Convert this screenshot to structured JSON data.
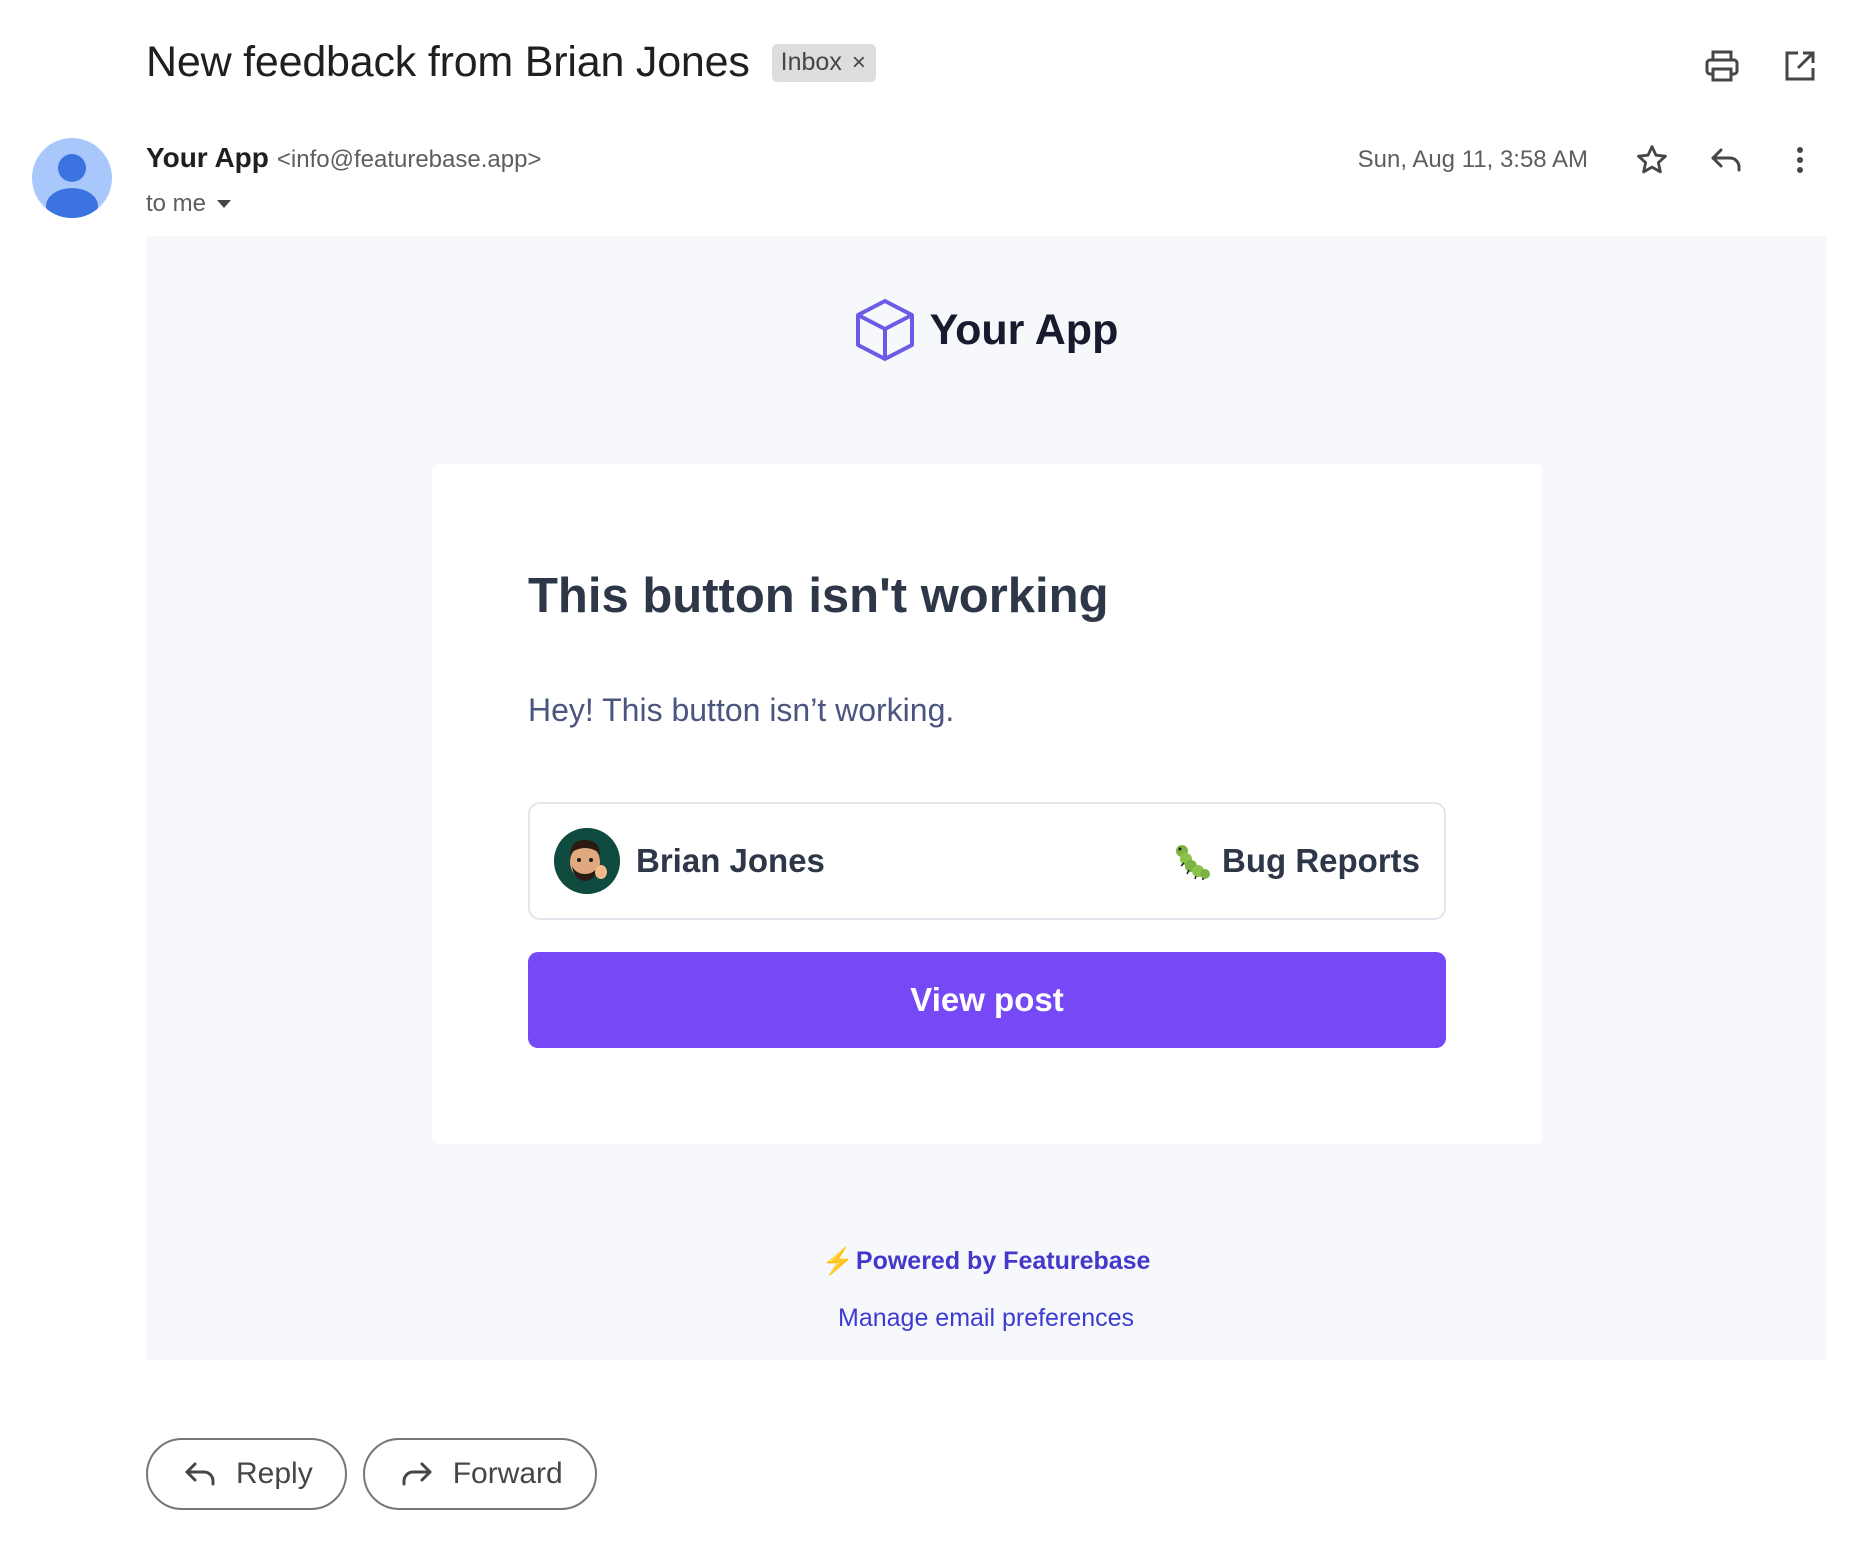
{
  "email": {
    "subject": "New feedback from Brian Jones",
    "label": "Inbox",
    "label_remove": "×",
    "sender_name": "Your App",
    "sender_email": "<info@featurebase.app>",
    "recipient": "to me",
    "timestamp": "Sun, Aug 11, 3:58 AM"
  },
  "icons": {
    "print": "print-icon",
    "open_new_window": "open-in-new-window-icon",
    "star": "star-icon",
    "reply": "reply-icon",
    "more": "more-vertical-icon",
    "forward": "forward-icon"
  },
  "body": {
    "brand_name": "Your App",
    "post_title": "This button isn't working",
    "post_text": "Hey! This button isn’t working.",
    "author_name": "Brian Jones",
    "board_name": "Bug Reports",
    "view_button": "View post",
    "powered_by": "Powered by Featurebase",
    "manage_prefs": "Manage email preferences"
  },
  "actions": {
    "reply": "Reply",
    "forward": "Forward"
  },
  "colors": {
    "accent": "#7748f5",
    "brand_icon": "#6b5ce7",
    "link": "#4338ca",
    "body_bg": "#f7f8fb"
  }
}
